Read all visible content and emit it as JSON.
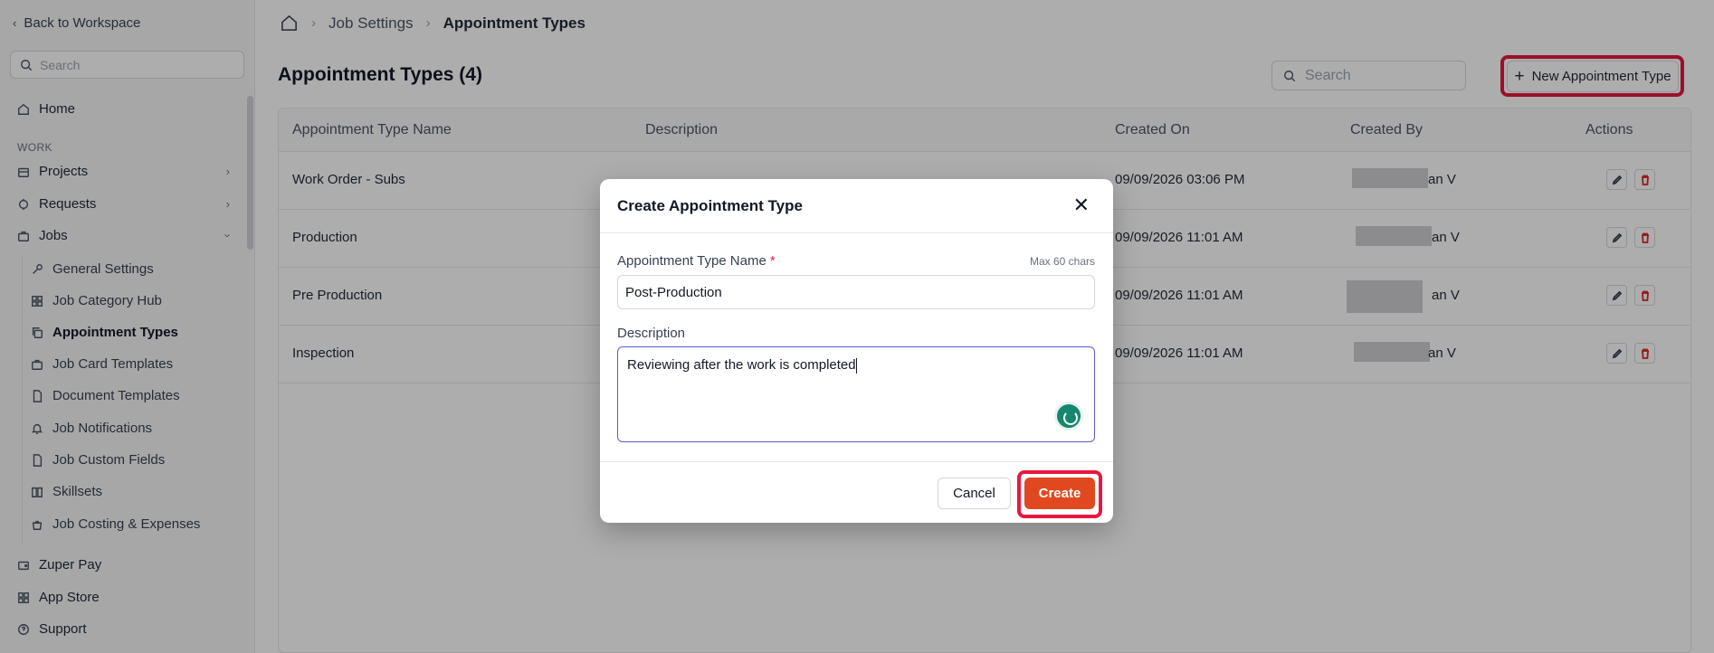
{
  "sidebar": {
    "back_label": "Back to Workspace",
    "search_placeholder": "Search",
    "home": "Home",
    "section_label": "WORK",
    "items": [
      {
        "label": "Projects",
        "icon": "projects-icon"
      },
      {
        "label": "Requests",
        "icon": "requests-icon"
      },
      {
        "label": "Jobs",
        "icon": "jobs-icon"
      }
    ],
    "jobs_sub": [
      {
        "label": "General Settings"
      },
      {
        "label": "Job Category Hub"
      },
      {
        "label": "Appointment Types"
      },
      {
        "label": "Job Card Templates"
      },
      {
        "label": "Document Templates"
      },
      {
        "label": "Job Notifications"
      },
      {
        "label": "Job Custom Fields"
      },
      {
        "label": "Skillsets"
      },
      {
        "label": "Job Costing & Expenses"
      }
    ],
    "bottom": [
      {
        "label": "Zuper Pay"
      },
      {
        "label": "App Store"
      },
      {
        "label": "Support"
      }
    ]
  },
  "breadcrumb": {
    "level1": "Job Settings",
    "current": "Appointment Types"
  },
  "page": {
    "title": "Appointment Types (4)",
    "search_placeholder": "Search",
    "new_button": "New Appointment Type"
  },
  "table": {
    "headers": [
      "Appointment Type Name",
      "Description",
      "Created On",
      "Created By",
      "Actions"
    ],
    "rows": [
      {
        "name": "Work Order - Subs",
        "created_on": "09/09/2026 03:06 PM",
        "created_by": "an V"
      },
      {
        "name": "Production",
        "created_on": "09/09/2026 11:01 AM",
        "created_by": "an V"
      },
      {
        "name": "Pre Production",
        "created_on": "09/09/2026 11:01 AM",
        "created_by": "an V"
      },
      {
        "name": "Inspection",
        "created_on": "09/09/2026 11:01 AM",
        "created_by": "an V"
      }
    ]
  },
  "modal": {
    "title": "Create Appointment Type",
    "name_label": "Appointment Type Name",
    "required_mark": "*",
    "max_chars": "Max 60 chars",
    "name_value": "Post-Production",
    "desc_label": "Description",
    "desc_value": "Reviewing after the work is completed",
    "cancel": "Cancel",
    "create": "Create"
  },
  "colors": {
    "primary_button": "#e0491f",
    "highlight": "#e8173f",
    "focus_border": "#5b5bd6"
  }
}
